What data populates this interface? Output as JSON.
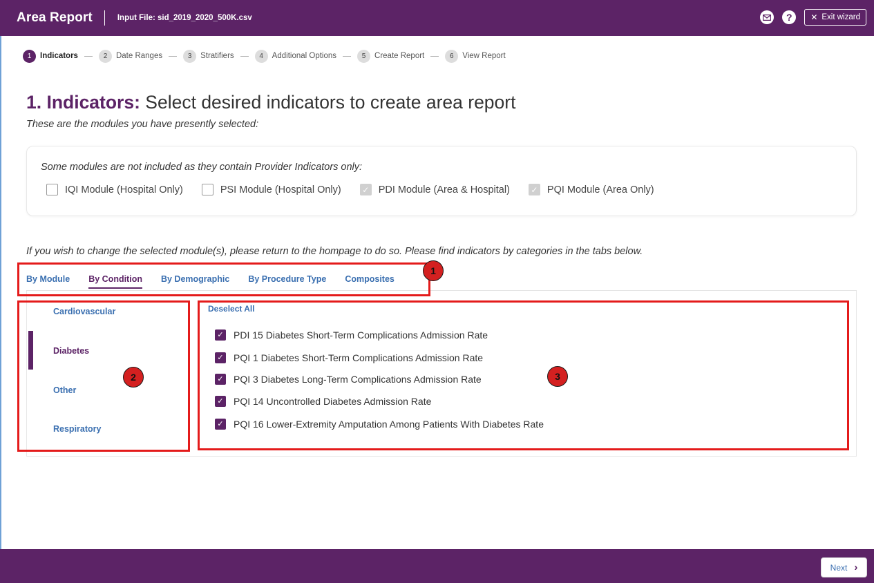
{
  "header": {
    "app_title": "Area Report",
    "input_file": "Input File: sid_2019_2020_500K.csv",
    "help_glyph": "?",
    "exit_label": "Exit wizard",
    "exit_glyph": "✕"
  },
  "stepper": [
    {
      "num": "1",
      "label": "Indicators"
    },
    {
      "num": "2",
      "label": "Date Ranges"
    },
    {
      "num": "3",
      "label": "Stratifiers"
    },
    {
      "num": "4",
      "label": "Additional Options"
    },
    {
      "num": "5",
      "label": "Create Report"
    },
    {
      "num": "6",
      "label": "View Report"
    }
  ],
  "page": {
    "title_strong": "1. Indicators:",
    "title_rest": " Select desired indicators to create area report",
    "subtitle": "These are the modules you have presently selected:",
    "module_note": "Some modules are not included as they contain Provider Indicators only:",
    "modules": [
      {
        "label": "IQI Module (Hospital Only)",
        "state": "unchecked"
      },
      {
        "label": "PSI Module (Hospital Only)",
        "state": "unchecked"
      },
      {
        "label": "PDI Module (Area & Hospital)",
        "state": "checked-disabled"
      },
      {
        "label": "PQI Module (Area Only)",
        "state": "checked-disabled"
      }
    ],
    "info": "If you wish to change the selected module(s), please return to the hompage to do so. Please find indicators by categories in the tabs below."
  },
  "tabs": [
    "By Module",
    "By Condition",
    "By Demographic",
    "By Procedure Type",
    "Composites"
  ],
  "active_tab": "By Condition",
  "categories": [
    "Cardiovascular",
    "Diabetes",
    "Other",
    "Respiratory"
  ],
  "active_category": "Diabetes",
  "deselect_all": "Deselect All",
  "indicators": [
    "PDI 15 Diabetes Short-Term Complications Admission Rate",
    "PQI 1 Diabetes Short-Term Complications Admission Rate",
    "PQI 3 Diabetes Long-Term Complications Admission Rate",
    "PQI 14 Uncontrolled Diabetes Admission Rate",
    "PQI 16 Lower-Extremity Amputation Among Patients With Diabetes Rate"
  ],
  "check_glyph": "✓",
  "annotations": {
    "badge1": "1",
    "badge2": "2",
    "badge3": "3"
  },
  "footer": {
    "next_label": "Next",
    "next_glyph": "›"
  },
  "colors": {
    "brand": "#5c2366",
    "link": "#3a6fb0",
    "annotation": "#e41b1b"
  }
}
